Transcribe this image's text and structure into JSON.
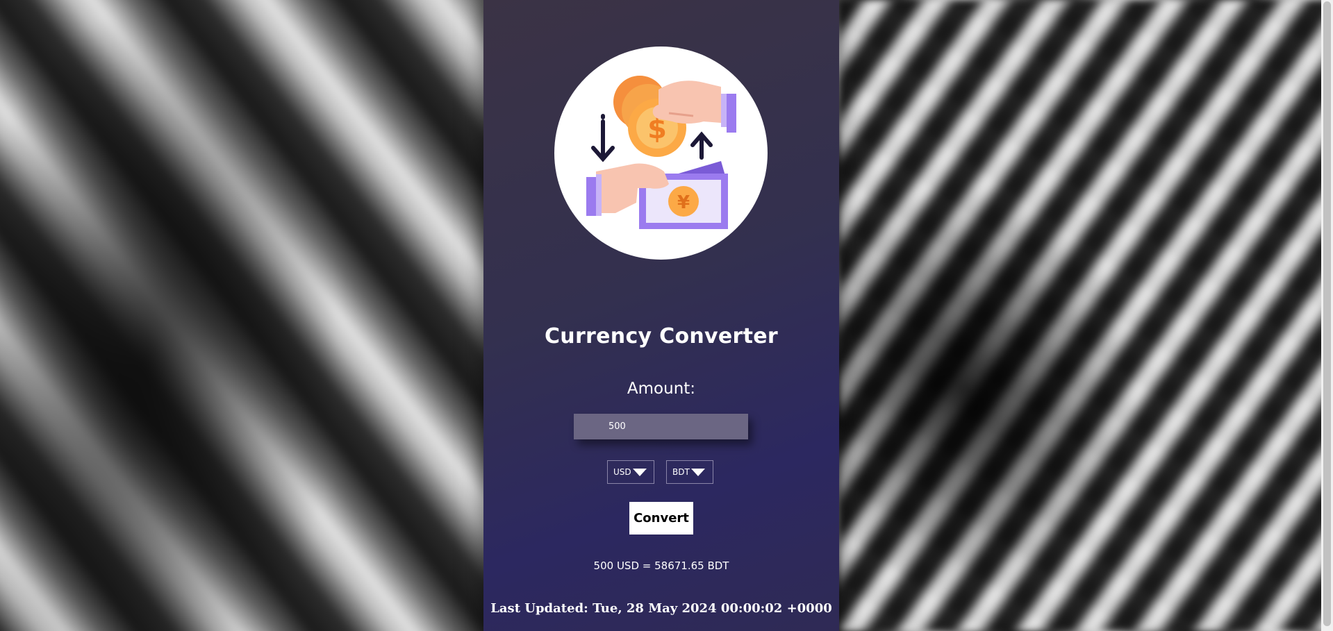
{
  "app": {
    "title": "Currency Converter"
  },
  "form": {
    "amount_label": "Amount:",
    "amount_value": "500",
    "from_currency": "USD",
    "to_currency": "BDT",
    "convert_label": "Convert"
  },
  "result": {
    "text": "500 USD = 58671.65 BDT"
  },
  "footer": {
    "last_updated": "Last Updated: Tue, 28 May 2024 00:00:02 +0000"
  },
  "colors": {
    "panel": "#33304f",
    "accent_orange": "#f7a44a",
    "accent_purple": "#9b7bef",
    "skin": "#f8c4b0"
  },
  "icons": {
    "logo": "currency-exchange-hands-icon",
    "caret": "triangle-down-icon"
  }
}
